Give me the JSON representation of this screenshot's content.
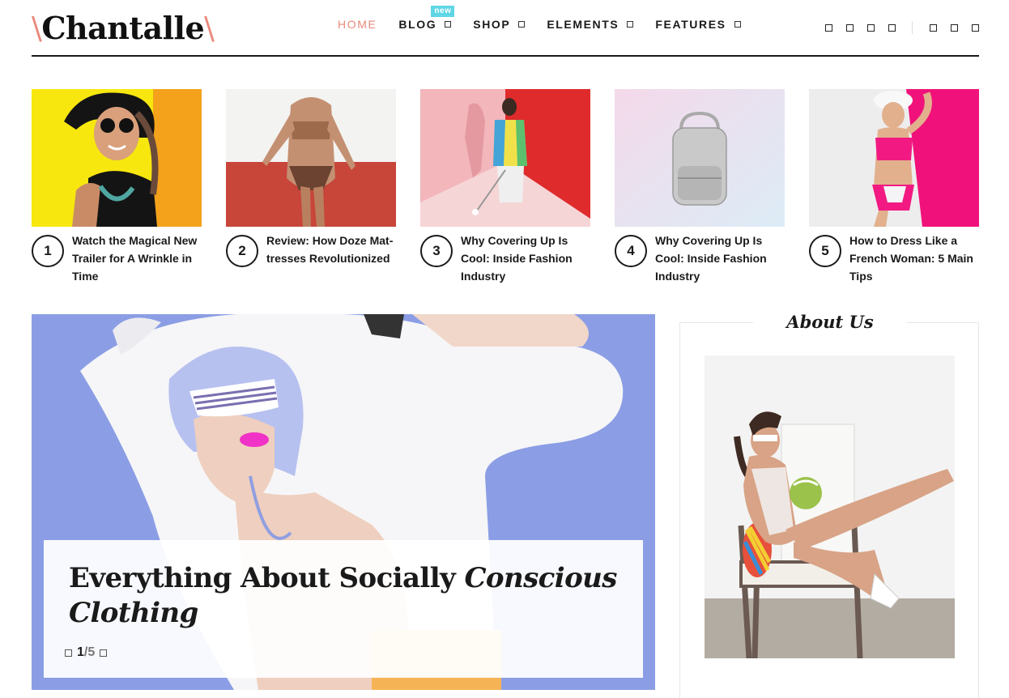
{
  "brand": {
    "name": "Chantalle",
    "slash_left": "\\",
    "slash_right": "\\"
  },
  "nav": {
    "home": "HOME",
    "blog": "BLOG",
    "blog_badge": "new",
    "shop": "SHOP",
    "elements": "ELEMENTS",
    "features": "FEATURES"
  },
  "header_icons": [
    "social-icon",
    "social-icon",
    "social-icon",
    "social-icon",
    "search-icon",
    "cart-icon",
    "menu-icon"
  ],
  "posts": [
    {
      "number": "1",
      "title": "Watch the Magical New Trailer for A Wrinkle in Time"
    },
    {
      "number": "2",
      "title": "Review: How Doze Mat­tresses Revolutionized"
    },
    {
      "number": "3",
      "title": "Why Covering Up Is Cool: Inside Fashion Industry"
    },
    {
      "number": "4",
      "title": "Why Covering Up Is Cool: Inside Fashion Industry"
    },
    {
      "number": "5",
      "title": "How to Dress Like a French Woman: 5 Main Tips"
    }
  ],
  "hero": {
    "title_plain": "Everything About Socially ",
    "title_italic_1": "Conscious",
    "title_italic_2": "Clothing",
    "current": "1",
    "total": "/5"
  },
  "about": {
    "title": "About Us"
  },
  "colors": {
    "accent": "#e9897b",
    "badge": "#5ed6e6",
    "hero_bg": "#8b9ee5"
  }
}
